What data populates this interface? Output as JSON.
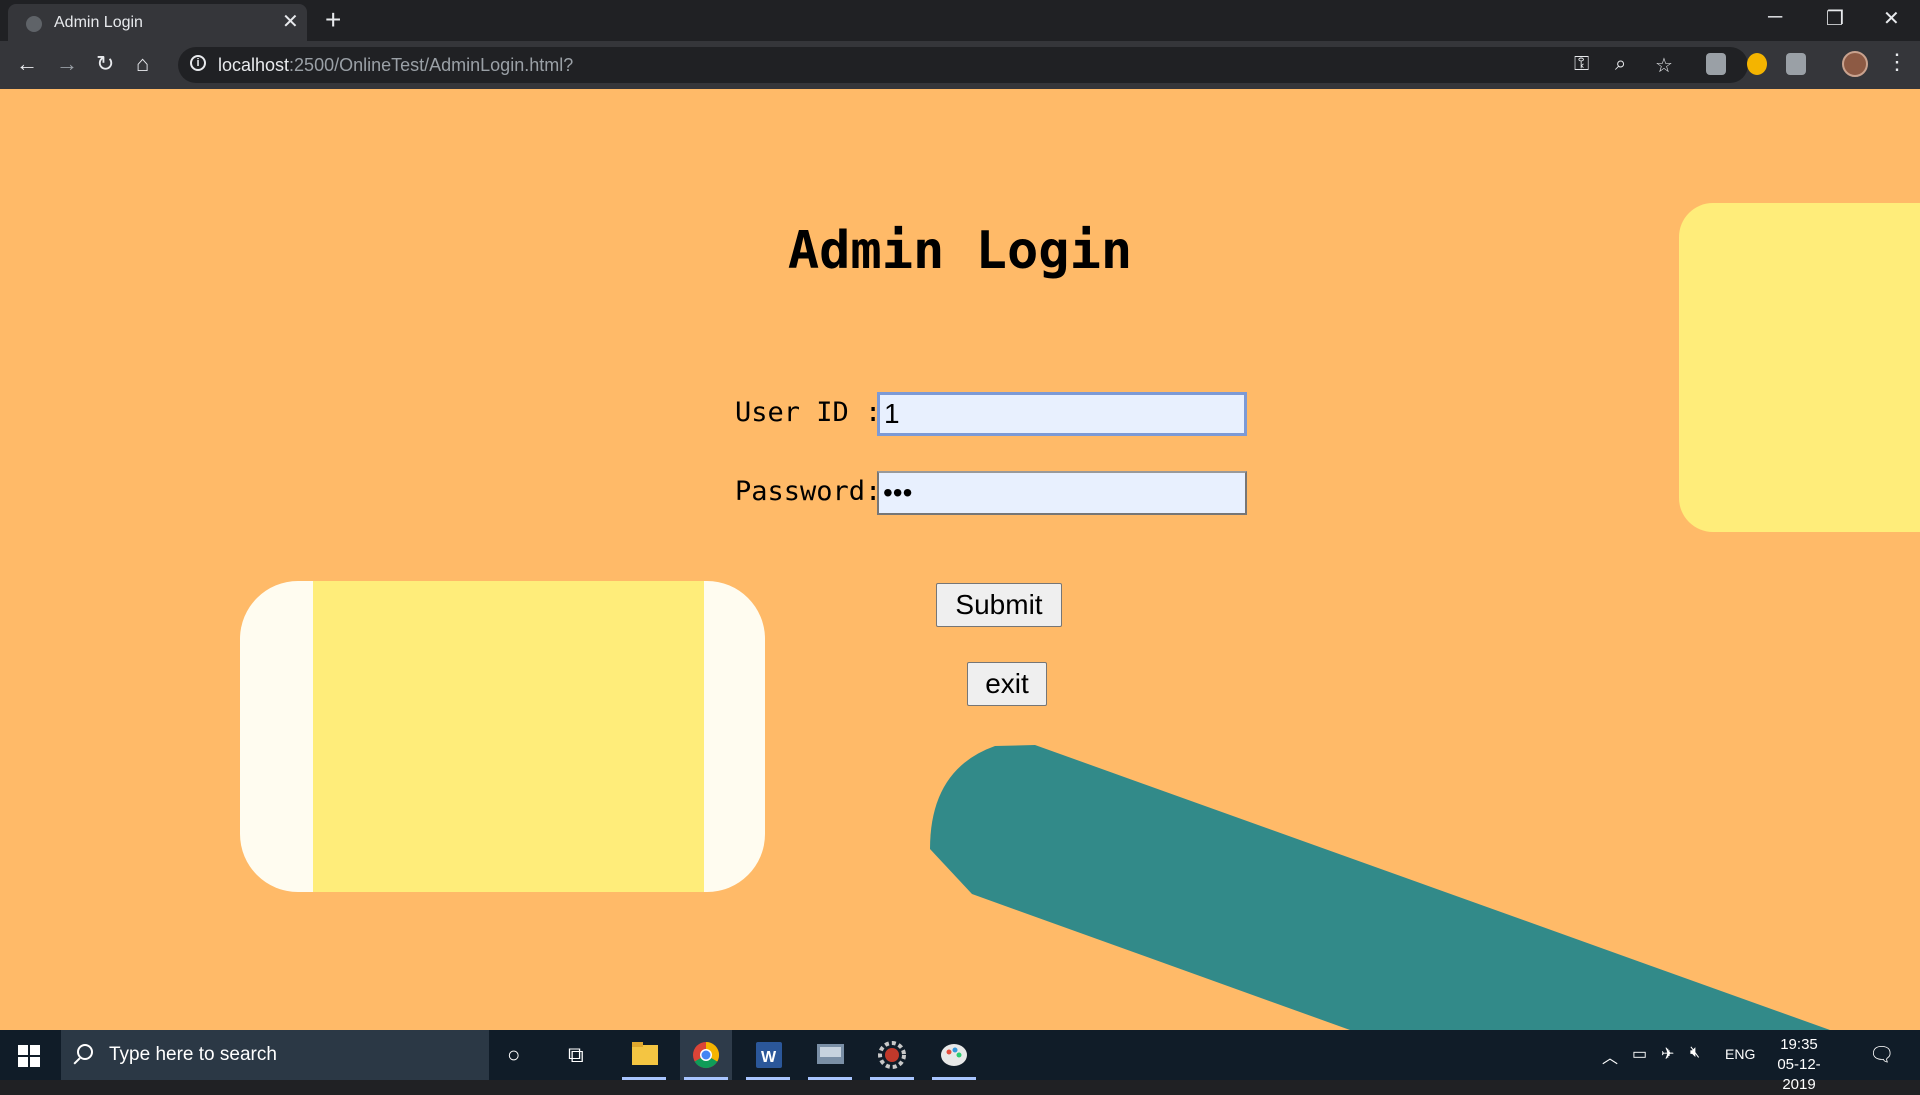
{
  "browser": {
    "tab_title": "Admin Login",
    "url_host": "localhost",
    "url_rest": ":2500/OnlineTest/AdminLogin.html?"
  },
  "page": {
    "heading": "Admin Login",
    "user_id_label": "User ID :",
    "user_id_value": "1",
    "password_label": "Password:",
    "password_value": "•••",
    "submit_label": "Submit",
    "exit_label": "exit",
    "colors": {
      "background": "#ffba68",
      "yellow_shape": "#ffed7a",
      "cream_shape": "#fffcf0",
      "teal_shape": "#328a89"
    }
  },
  "taskbar": {
    "search_placeholder": "Type here to search",
    "language": "ENG",
    "time": "19:35",
    "date": "05-12-2019",
    "pinned_apps": [
      "file-explorer-icon",
      "chrome-icon",
      "word-icon",
      "media-app-icon",
      "settings-gear-app-icon",
      "paint-app-icon"
    ]
  }
}
